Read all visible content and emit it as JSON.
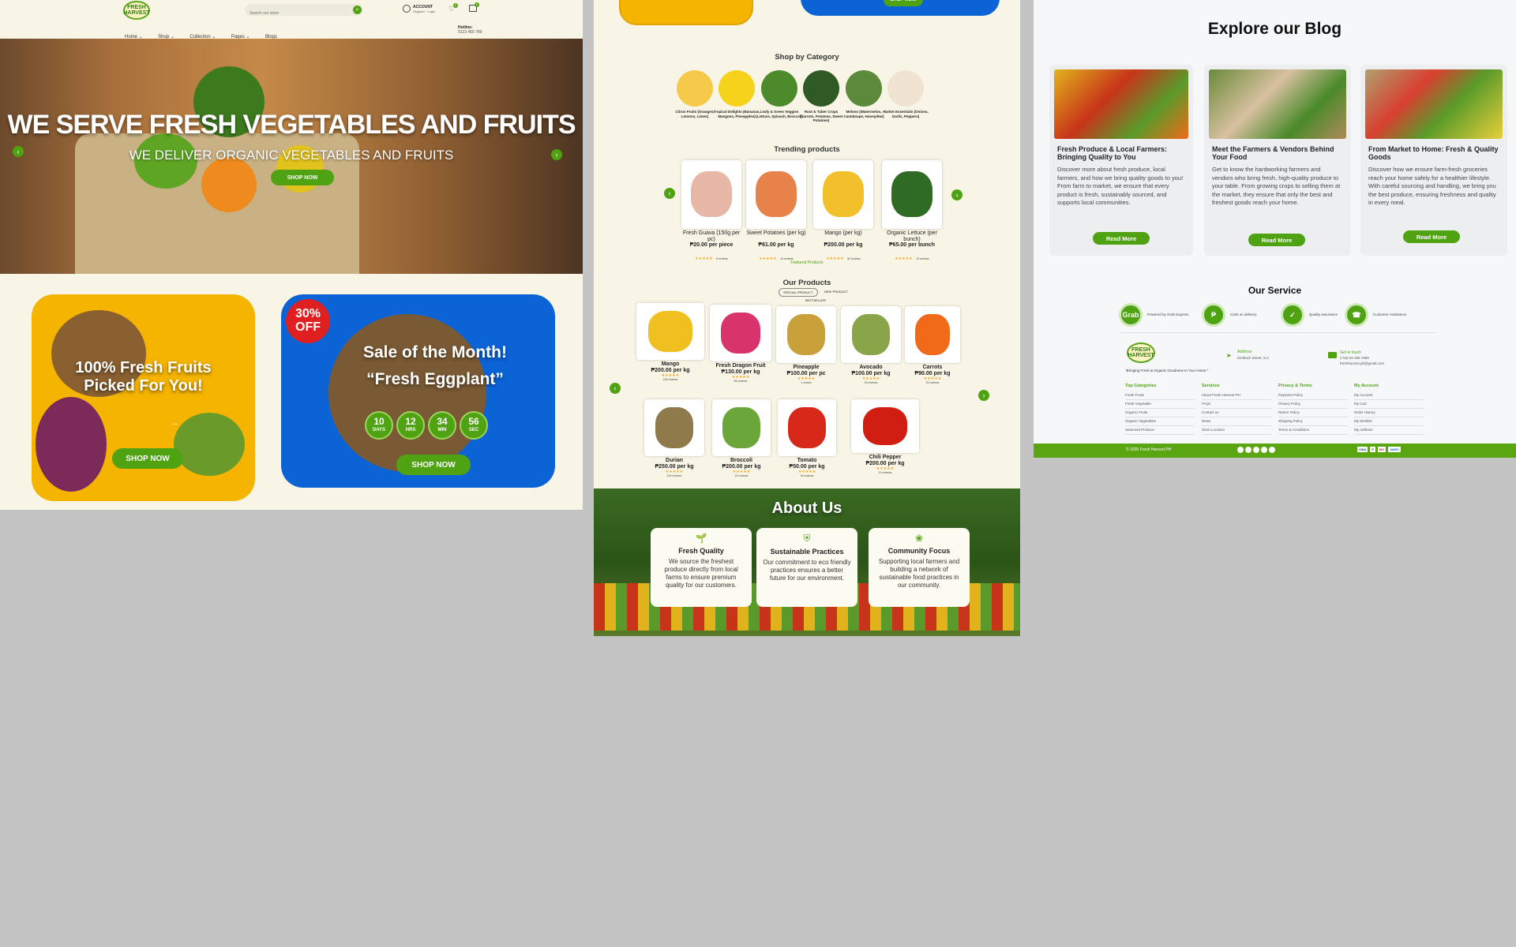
{
  "colors": {
    "brand_green": "#4fa312",
    "cream": "#f8f5e6",
    "hero_brown": "#a9703c",
    "promo_yellow": "#f5b400",
    "promo_blue": "#0b63d6",
    "badge_red": "#e02020"
  },
  "header": {
    "logo_line1": "FRESH",
    "logo_line2": "HARVEST",
    "search_placeholder": "Search our store",
    "account_label": "ACCOUNT",
    "account_sub": "Register · Login",
    "wishlist_count": "0",
    "cart_count": "0",
    "nav": [
      "Home ⌄",
      "Shop ⌄",
      "Collection ⌄",
      "Pages ⌄",
      "Blogs"
    ],
    "hotline_label": "Hotline:",
    "hotline_number": "0123 456 789"
  },
  "hero": {
    "title": "WE SERVE FRESH VEGETABLES AND FRUITS",
    "subtitle": "WE DELIVER ORGANIC VEGETABLES AND FRUITS",
    "cta": "SHOP NOW"
  },
  "promo1": {
    "title_line1": "100% Fresh Fruits",
    "title_line2": "Picked For You!",
    "cta": "SHOP NOW"
  },
  "promo2": {
    "badge_pct": "30%",
    "badge_off": "OFF",
    "title": "Sale of the Month!",
    "subtitle": "“Fresh Eggplant”",
    "cta": "SHOP NOW",
    "countdown": [
      {
        "value": "10",
        "unit": "DAYS"
      },
      {
        "value": "12",
        "unit": "HRS"
      },
      {
        "value": "34",
        "unit": "MIN"
      },
      {
        "value": "56",
        "unit": "SEC"
      }
    ]
  },
  "p2_top": {
    "cta": "SHOP NOW"
  },
  "categories": {
    "title": "Shop by Category",
    "items": [
      {
        "label": "Citrus Fruits (Oranges, Lemons, Limes)",
        "color": "#f7c94a"
      },
      {
        "label": "Tropical Delights (Bananas, Mangoes, Pineapples)",
        "color": "#f6d21a"
      },
      {
        "label": "Leafy & Green Veggies (Lettuce, Spinach, Broccoli)",
        "color": "#4c8a2c"
      },
      {
        "label": "Root & Tuber Crops (Carrots, Potatoes, Sweet Potatoes)",
        "color": "#2f5a26"
      },
      {
        "label": "Melons (Watermelon, Cantaloupe, Honeydew)",
        "color": "#5b8a3a"
      },
      {
        "label": "Market Essentials (Onions, Garlic, Peppers)",
        "color": "#f1e3d1"
      }
    ]
  },
  "trending": {
    "title": "Trending products",
    "featured": "Featured Products",
    "items": [
      {
        "name": "Fresh Guava (150g per pc)",
        "price": "₱20.00 per piece",
        "reviews": "8 reviews",
        "color": "#e7b7a8"
      },
      {
        "name": "Sweet Potatoes (per kg)",
        "price": "₱61.00 per kg",
        "reviews": "10 reviews",
        "color": "#e7824a"
      },
      {
        "name": "Mango (per kg)",
        "price": "₱200.00 per kg",
        "reviews": "50 reviews",
        "color": "#f2c02b"
      },
      {
        "name": "Organic Lettuce (per bunch)",
        "price": "₱65.00 per bunch",
        "reviews": "10 reviews",
        "color": "#2f6b24"
      }
    ]
  },
  "products": {
    "title": "Our Products",
    "tabs": [
      "SPECIAL PRODUCT",
      "NEW PRODUCT",
      "BESTSELLER"
    ],
    "items": [
      {
        "name": "Mango",
        "price": "₱200.00 per kg",
        "reviews": "109 reviews",
        "color": "#f0c020"
      },
      {
        "name": "Fresh Dragon Fruit",
        "price": "₱130.00 per kg",
        "reviews": "50 reviews",
        "color": "#d8336a"
      },
      {
        "name": "Pineapple",
        "price": "₱100.00 per pc",
        "reviews": "1 review",
        "color": "#c8a13a"
      },
      {
        "name": "Avocado",
        "price": "₱100.00 per kg",
        "reviews": "30 reviews",
        "color": "#8aa44a"
      },
      {
        "name": "Carrots",
        "price": "₱90.00 per kg",
        "reviews": "20 reviews",
        "color": "#f06a1a"
      },
      {
        "name": "Durian",
        "price": "₱250.00 per kg",
        "reviews": "100 reviews",
        "color": "#8e7a4a"
      },
      {
        "name": "Broccoli",
        "price": "₱200.00 per kg",
        "reviews": "20 reviews",
        "color": "#6aa63a"
      },
      {
        "name": "Tomato",
        "price": "₱50.00 per kg",
        "reviews": "30 reviews",
        "color": "#d8281a"
      },
      {
        "name": "Chili Pepper",
        "price": "₱200.00 per kg",
        "reviews": "10 reviews",
        "color": "#d01e12"
      }
    ]
  },
  "about": {
    "title": "About Us",
    "cards": [
      {
        "title": "Fresh Quality",
        "text": "We source the freshest produce directly from local farms to ensure premium quality for our customers."
      },
      {
        "title": "Sustainable Practices",
        "text": "Our commitment to eco friendly practices ensures a better future for our environment."
      },
      {
        "title": "Community Focus",
        "text": "Supporting local farmers and building a network of sustainable food practices in our community."
      }
    ]
  },
  "blog": {
    "title": "Explore our Blog",
    "read_more": "Read More",
    "posts": [
      {
        "title": "Fresh Produce & Local Farmers: Bringing Quality to You",
        "text": "Discover more about fresh produce, local farmers, and how we bring quality goods to you! From farm to market, we ensure that every product is fresh, sustainably sourced, and supports local communities."
      },
      {
        "title": "Meet the Farmers & Vendors Behind Your Food",
        "text": "Get to know the hardworking farmers and vendors who bring fresh, high-quality produce to your table. From growing crops to selling them at the market, they ensure that only the best and freshest goods reach your home."
      },
      {
        "title": "From Market to Home: Fresh & Quality Goods",
        "text": "Discover how we ensure farm-fresh groceries reach your home safely for a healthier lifestyle. With careful sourcing and handling, we bring you the best produce, ensuring freshness and quality in every meal."
      }
    ]
  },
  "service": {
    "title": "Our Service",
    "items": [
      {
        "icon": "Grab",
        "label": "Powered by Grab Express"
      },
      {
        "icon": "₱",
        "label": "Cash on delivery"
      },
      {
        "icon": "✓",
        "label": "Quality assurance"
      },
      {
        "icon": "☎",
        "label": "Customer Assistance"
      }
    ]
  },
  "footer": {
    "tagline": "\"Bringing Fresh & Organic Goodness to Your Home.\"",
    "address_label": "Address",
    "address_value": "28 Black Street, S.C",
    "contact_label": "Get in touch",
    "contact_phone": "(+63) 02 456 7890",
    "contact_email": "freshharvest.ph@gmail.com",
    "columns": [
      {
        "title": "Top Categories",
        "links": [
          "Fresh Fruits",
          "Fresh Vegetable",
          "Organic Fruits",
          "Organic Vegetables",
          "Seasonal Produce"
        ]
      },
      {
        "title": "Services",
        "links": [
          "About Fresh Harvest PH",
          "FAQs",
          "Contact us",
          "News",
          "Store Location"
        ]
      },
      {
        "title": "Privacy & Terms",
        "links": [
          "Payment Policy",
          "Privacy Policy",
          "Return Policy",
          "Shipping Policy",
          "Terms & Conditions"
        ]
      },
      {
        "title": "My Account",
        "links": [
          "My Account",
          "My Cart",
          "Order History",
          "My Wishlist",
          "My Address"
        ]
      }
    ],
    "copyright": "© 2025 Fresh Harvest PH",
    "payments": [
      "VISA",
      "P",
      "MC",
      "AMEX"
    ]
  }
}
